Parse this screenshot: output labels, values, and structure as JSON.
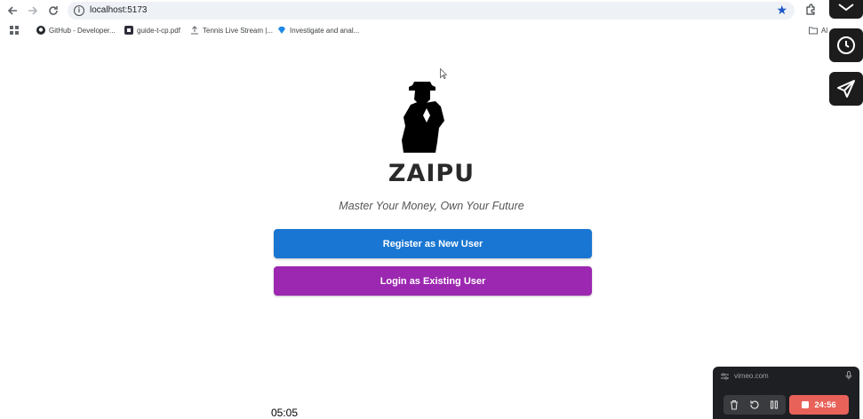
{
  "browser": {
    "url": "localhost:5173",
    "bookmarks": [
      {
        "label": "GitHub - Developer...",
        "icon": "github-icon"
      },
      {
        "label": "guide-t-cp.pdf",
        "icon": "pdf-icon"
      },
      {
        "label": "Tennis Live Stream |...",
        "icon": "upload-icon"
      },
      {
        "label": "Investigate and anal...",
        "icon": "gem-icon"
      }
    ],
    "bookmarks_overflow_label": "Al"
  },
  "app": {
    "brand": "ZAIPU",
    "tagline": "Master Your Money, Own Your Future",
    "register_label": "Register as New User",
    "login_label": "Login as Existing User",
    "colors": {
      "register": "#1976d2",
      "login": "#9c27b0"
    }
  },
  "recorder": {
    "domain": "vimeo.com",
    "timer": "24:56"
  },
  "video_timestamp": "05:05"
}
